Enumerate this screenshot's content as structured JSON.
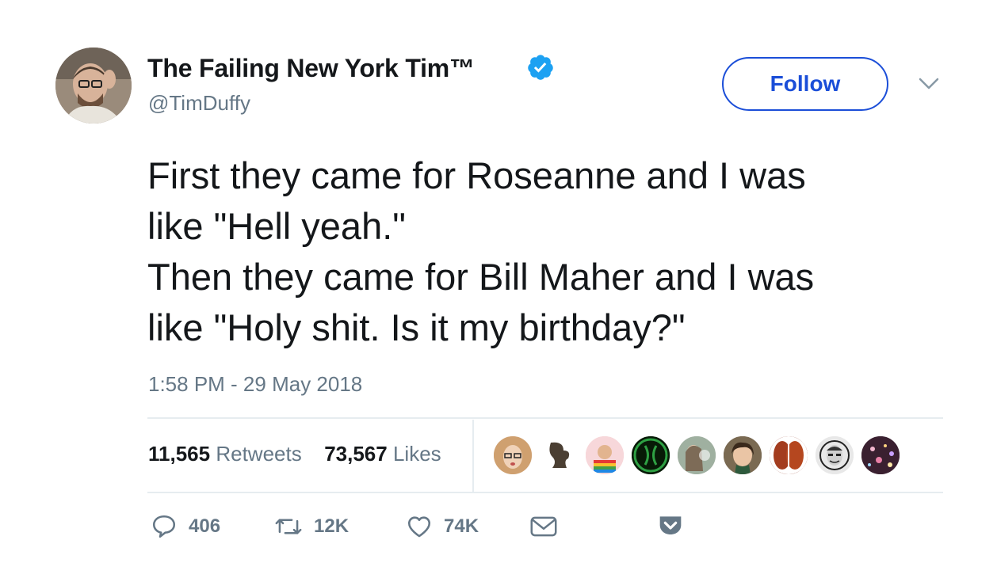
{
  "author": {
    "display_name": "The Failing New York Tim™",
    "handle": "@TimDuffy",
    "verified_icon": "verified-badge-icon",
    "avatar_icon": "avatar-photo"
  },
  "header": {
    "follow_label": "Follow",
    "menu_icon": "chevron-down-icon"
  },
  "tweet": {
    "text": "First they came for Roseanne and I was\nlike \"Hell yeah.\"\nThen they came for Bill Maher and I was\nlike \"Holy shit. Is it my birthday?\"",
    "timestamp": "1:58 PM - 29 May 2018"
  },
  "stats": {
    "retweets_count": "11,565",
    "retweets_label": "Retweets",
    "likes_count": "73,567",
    "likes_label": "Likes"
  },
  "actions": {
    "reply_count": "406",
    "retweet_count": "12K",
    "like_count": "74K"
  },
  "colors": {
    "accent": "#1b4ed8",
    "verified": "#1da1f2",
    "muted": "#657786",
    "text": "#14171a"
  }
}
